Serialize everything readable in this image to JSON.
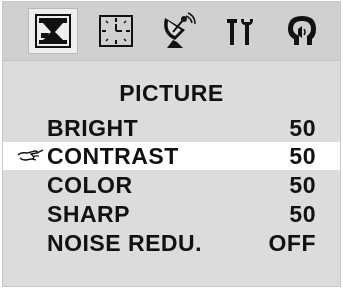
{
  "tabs": [
    {
      "icon": "picture-icon",
      "active": true
    },
    {
      "icon": "clock-icon",
      "active": false
    },
    {
      "icon": "satellite-dish-icon",
      "active": false
    },
    {
      "icon": "tools-icon",
      "active": false
    },
    {
      "icon": "speaker-ear-icon",
      "active": false
    }
  ],
  "menu": {
    "title": "PICTURE",
    "items": [
      {
        "label": "BRIGHT",
        "value": "50",
        "selected": false
      },
      {
        "label": "CONTRAST",
        "value": "50",
        "selected": true
      },
      {
        "label": "COLOR",
        "value": "50",
        "selected": false
      },
      {
        "label": "SHARP",
        "value": "50",
        "selected": false
      },
      {
        "label": "NOISE REDU.",
        "value": "OFF",
        "selected": false
      }
    ]
  },
  "cursor_icon": "hand-pointer-icon",
  "colors": {
    "background": "#dcdcdc",
    "tabbar": "#d0d0d0",
    "selected_row": "#ffffff",
    "text": "#111111"
  }
}
